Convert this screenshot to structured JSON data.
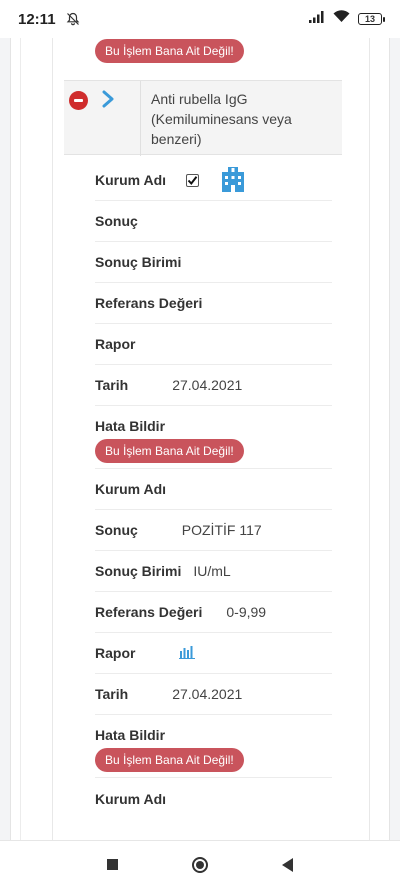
{
  "status_bar": {
    "time": "12:11",
    "battery": "13"
  },
  "top_error_button": "Bu İşlem Bana Ait Değil!",
  "test": {
    "name": "Anti rubella IgG (Kemiluminesans veya benzeri)"
  },
  "block1": {
    "kurum_label": "Kurum Adı",
    "sonuc_label": "Sonuç",
    "birim_label": "Sonuç Birimi",
    "referans_label": "Referans Değeri",
    "rapor_label": "Rapor",
    "tarih_label": "Tarih",
    "tarih_value": "27.04.2021",
    "hata_label": "Hata Bildir",
    "hata_button": "Bu İşlem Bana Ait Değil!"
  },
  "block2": {
    "kurum_label": "Kurum Adı",
    "sonuc_label": "Sonuç",
    "sonuc_value": "POZİTİF 117",
    "birim_label": "Sonuç Birimi",
    "birim_value": "IU/mL",
    "referans_label": "Referans Değeri",
    "referans_value": "0-9,99",
    "rapor_label": "Rapor",
    "tarih_label": "Tarih",
    "tarih_value": "27.04.2021",
    "hata_label": "Hata Bildir",
    "hata_button": "Bu İşlem Bana Ait Değil!"
  },
  "block3": {
    "kurum_label": "Kurum Adı"
  },
  "colors": {
    "error_button": "#c9545c",
    "accent_blue": "#3a9ad9",
    "remove_red": "#cf2c2c"
  }
}
